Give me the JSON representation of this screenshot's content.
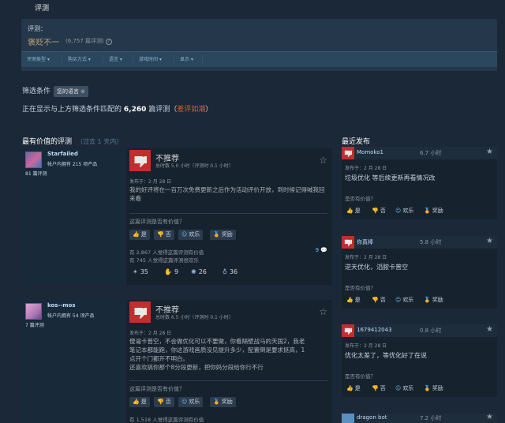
{
  "header": {
    "title": "评测"
  },
  "summary": {
    "label": "评测：",
    "value": "褒贬不一",
    "count": "(6,757 篇评测)",
    "help": "?"
  },
  "filter_bar": [
    "评测类型",
    "购买方式",
    "语言",
    "游戏时间",
    "显示"
  ],
  "filters": {
    "label": "筛选条件",
    "tag": "您的语言",
    "tag_close": "⊗"
  },
  "showing": {
    "prefix": "正在显示与上方筛选条件匹配的",
    "count": "6,260",
    "suffix": "篇评测（",
    "link": "差评如潮",
    "close": "）"
  },
  "sections": {
    "most_helpful": "最有价值的评测",
    "most_helpful_sub": "（过去 1 天内）",
    "recent": "最近发布"
  },
  "colors": {
    "negative": "#c22d2d",
    "accent_link": "#66c0f4",
    "mixed": "#b9a074",
    "negative_link": "#e05a3a"
  },
  "reviews": [
    {
      "author": "Starfailed",
      "games": "帐户内拥有 215 项产品",
      "review_count": "81 篇评测",
      "verdict": "不推荐",
      "hours": "总时数 5.0 小时（评测时 0.1 小时）",
      "posted": "发布于：2 月 28 日",
      "text": "我的好评将在一百万次免费更新之后作为活动评价开放，到时候记得喊我回来看",
      "helpful_q": "这篇评测是否有价值？",
      "btn_yes": "是",
      "btn_no": "否",
      "btn_funny": "欢乐",
      "btn_award": "奖励",
      "stat1": "有 2,867 人觉得这篇评测有价值",
      "stat2": "有 745 人觉得这篇评测很欢乐",
      "comments": "9",
      "awards": [
        "35",
        "9",
        "26",
        "36"
      ]
    },
    {
      "author": "kos--mos",
      "games": "帐户内拥有 54 项产品",
      "review_count": "7 篇评测",
      "verdict": "不推荐",
      "hours": "总时数 6.5 小时（评测时 0.1 小时）",
      "posted": "发布于：2 月 28 日",
      "text": "傻逼卡普空，不会做优化可以不要做，你看隔壁战马的天国2，我老\n笔记本都能跑，你这游戏画质没见提升多少，配置倒是要求挺高，1\n点开个门都开不明白。\n还喜欢搞你那个8分段更新，把你妈分段给你行不行",
      "helpful_q": "这篇评测是否有价值？",
      "btn_yes": "是",
      "btn_no": "否",
      "btn_funny": "欢乐",
      "btn_award": "奖励",
      "stat1": "有 1,518 人觉得这篇评测有价值"
    }
  ],
  "recent": [
    {
      "name": "Momoko1",
      "hours": "6.7 小时",
      "posted": "发布于：2 月 28 日",
      "text": "垃圾优化 等后续更新再看情况改",
      "q": "是否有价值？",
      "yes": "是",
      "no": "否",
      "funny": "欢乐",
      "award": "奖励"
    },
    {
      "name": "你真棒",
      "hours": "5.8 小时",
      "posted": "发布于：2 月 28 日",
      "text": "逆天优化，滔脓卡普空",
      "q": "是否有价值？",
      "yes": "是",
      "no": "否",
      "funny": "欢乐",
      "award": "奖励"
    },
    {
      "name": "1679412043",
      "hours": "0.8 小时",
      "posted": "发布于：2 月 28 日",
      "text": "优化太差了，等优化好了在说",
      "q": "是否有价值？",
      "yes": "是",
      "no": "否",
      "funny": "欢乐",
      "award": "奖励"
    },
    {
      "name": "dragon bot",
      "hours": "7.2 小时"
    }
  ]
}
